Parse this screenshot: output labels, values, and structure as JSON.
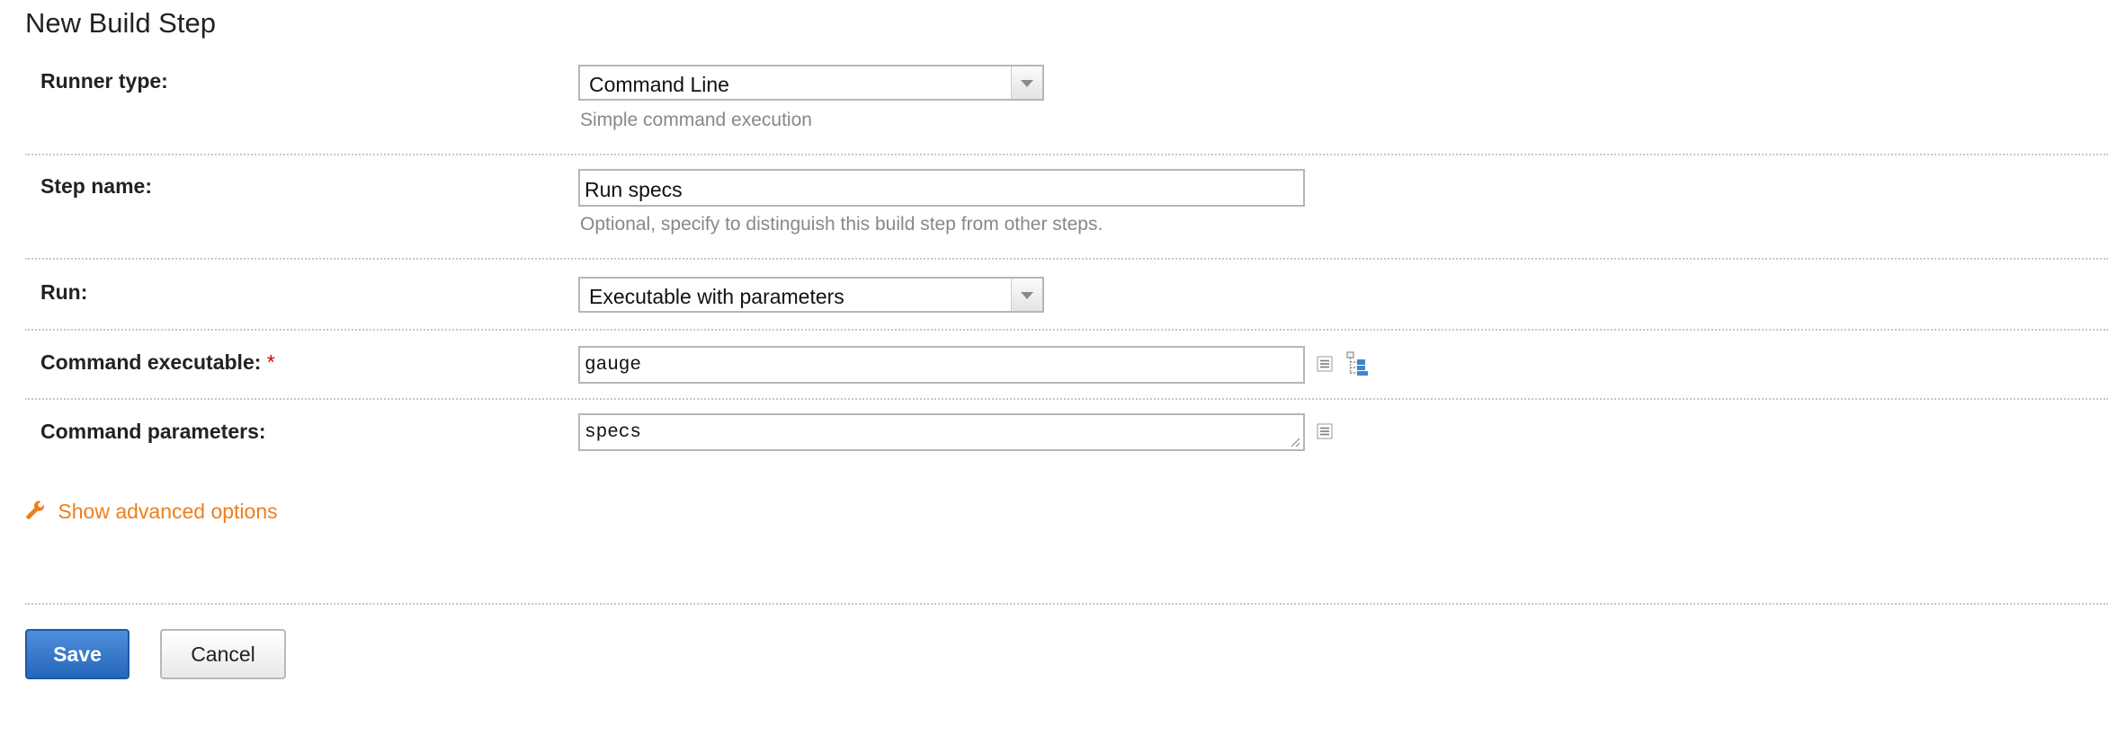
{
  "page": {
    "title": "New Build Step"
  },
  "form": {
    "runner_type": {
      "label": "Runner type:",
      "value": "Command Line",
      "hint": "Simple command execution"
    },
    "step_name": {
      "label": "Step name:",
      "value": "Run specs",
      "hint": "Optional, specify to distinguish this build step from other steps."
    },
    "run": {
      "label": "Run:",
      "value": "Executable with parameters"
    },
    "command_executable": {
      "label": "Command executable:",
      "required_mark": "*",
      "value": "gauge"
    },
    "command_parameters": {
      "label": "Command parameters:",
      "value": "specs"
    }
  },
  "advanced": {
    "label": "Show advanced options",
    "icon": "wrench-icon"
  },
  "buttons": {
    "save": "Save",
    "cancel": "Cancel"
  },
  "colors": {
    "accent_orange": "#ef7e1a",
    "save_blue": "#2567bd",
    "required_red": "#d00000",
    "hint_gray": "#888888"
  }
}
